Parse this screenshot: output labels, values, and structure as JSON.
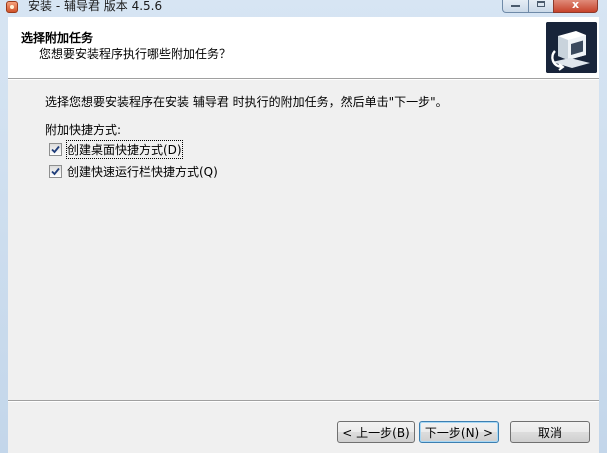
{
  "window": {
    "title": "安装 - 辅导君 版本 4.5.6",
    "controls": {
      "minimize": "minimize",
      "maximize": "maximize",
      "close": "x"
    }
  },
  "header": {
    "title": "选择附加任务",
    "subtitle": "您想要安装程序执行哪些附加任务？"
  },
  "main": {
    "description": "选择您想要安装程序在安装 辅导君 时执行的附加任务，然后单击\"下一步\"。",
    "group_label": "附加快捷方式:",
    "options": [
      {
        "label": "创建桌面快捷方式(D)",
        "checked": true
      },
      {
        "label": "创建快速运行栏快捷方式(Q)",
        "checked": true
      }
    ]
  },
  "buttons": {
    "back": "< 上一步(B)",
    "next": "下一步(N) >",
    "cancel": "取消"
  },
  "colors": {
    "accent": "#3c7fb1",
    "checkmark": "#1f3d7a",
    "wizard_image_bg": "#18243a"
  }
}
